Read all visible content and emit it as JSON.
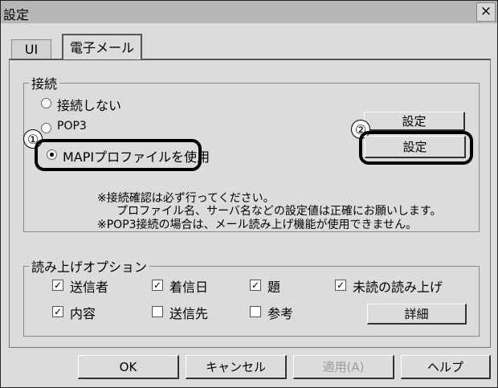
{
  "window": {
    "title": "設定",
    "close_label": "×"
  },
  "tabs": [
    {
      "label": "UI"
    },
    {
      "label": "電子メール"
    }
  ],
  "connection": {
    "legend": "接続",
    "options": [
      {
        "label": "接続しない",
        "selected": false
      },
      {
        "label": "POP3",
        "selected": false
      },
      {
        "label": "MAPIプロファイルを使用",
        "selected": true
      }
    ],
    "pop3_settings_label": "設定",
    "mapi_settings_label": "設定",
    "callout_1": "①",
    "callout_2": "②",
    "notes": [
      "※接続確認は必ず行ってください。",
      "プロファイル名、サーバ名などの設定値は正確にお願いします。",
      "※POP3接続の場合は、メール読み上げ機能が使用できません。"
    ]
  },
  "reading": {
    "legend": "読み上げオプション",
    "checkboxes": [
      {
        "label": "送信者",
        "checked": true
      },
      {
        "label": "着信日",
        "checked": true
      },
      {
        "label": "題",
        "checked": true
      },
      {
        "label": "未読の読み上げ",
        "checked": true
      },
      {
        "label": "内容",
        "checked": true
      },
      {
        "label": "送信先",
        "checked": false
      },
      {
        "label": "参考",
        "checked": false
      }
    ],
    "details_label": "詳細"
  },
  "footer": {
    "ok_label": "OK",
    "cancel_label": "キャンセル",
    "apply_label": "適用(A)",
    "help_label": "ヘルプ"
  }
}
